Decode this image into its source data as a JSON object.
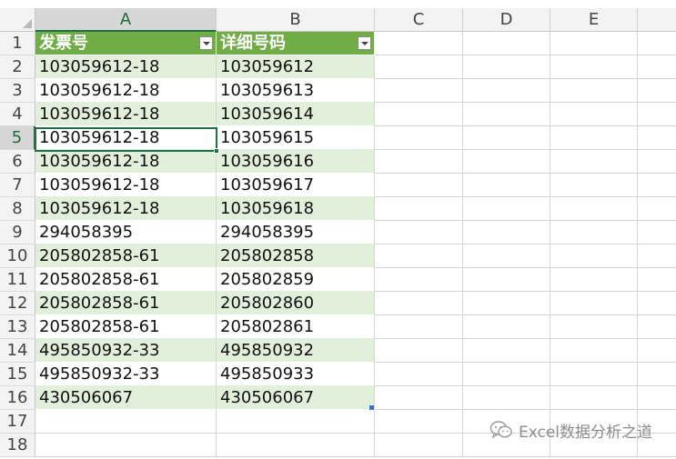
{
  "sheet": {
    "column_headers": [
      "A",
      "B",
      "C",
      "D",
      "E"
    ],
    "row_numbers": [
      "1",
      "2",
      "3",
      "4",
      "5",
      "6",
      "7",
      "8",
      "9",
      "10",
      "11",
      "12",
      "13",
      "14",
      "15",
      "16",
      "17",
      "18"
    ],
    "selected_column": "A",
    "selected_row": "5"
  },
  "table": {
    "headers": [
      "发票号",
      "详细号码"
    ],
    "rows": [
      [
        "103059612-18",
        "103059612"
      ],
      [
        "103059612-18",
        "103059613"
      ],
      [
        "103059612-18",
        "103059614"
      ],
      [
        "103059612-18",
        "103059615"
      ],
      [
        "103059612-18",
        "103059616"
      ],
      [
        "103059612-18",
        "103059617"
      ],
      [
        "103059612-18",
        "103059618"
      ],
      [
        "294058395",
        "294058395"
      ],
      [
        "205802858-61",
        "205802858"
      ],
      [
        "205802858-61",
        "205802859"
      ],
      [
        "205802858-61",
        "205802860"
      ],
      [
        "205802858-61",
        "205802861"
      ],
      [
        "495850932-33",
        "495850932"
      ],
      [
        "495850932-33",
        "495850933"
      ],
      [
        "430506067",
        "430506067"
      ]
    ],
    "active_cell": "A5",
    "colors": {
      "header": "#70ad47",
      "band": "#e2efda",
      "selection": "#1e7145"
    }
  },
  "watermark": {
    "text": "Excel数据分析之道",
    "icon": "wechat-icon"
  }
}
